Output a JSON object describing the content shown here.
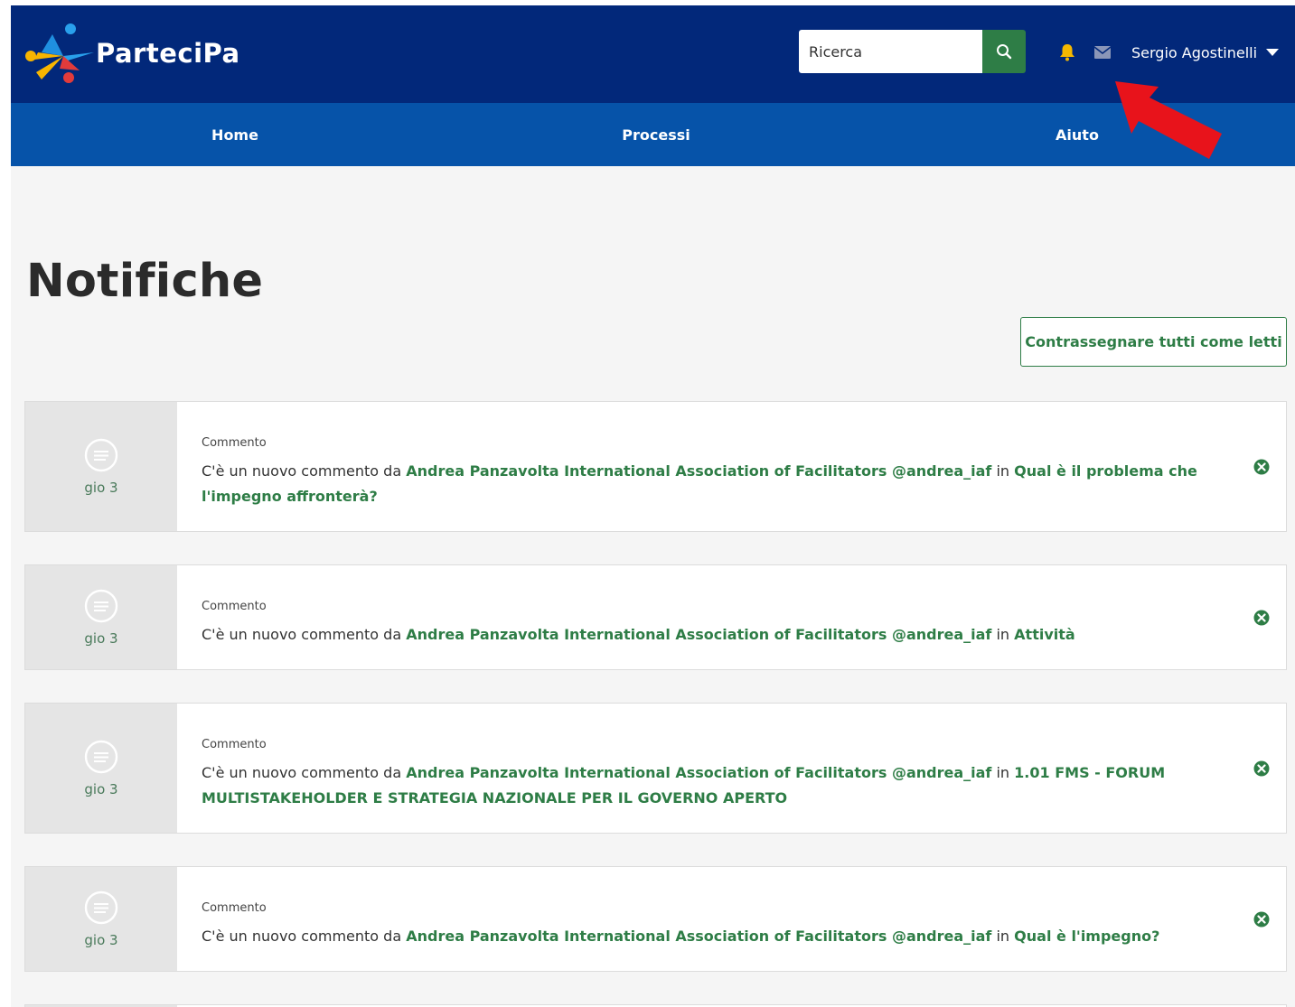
{
  "header": {
    "brand": "ParteciPa",
    "search_placeholder": "Ricerca",
    "user_name": "Sergio Agostinelli",
    "icons": {
      "search": "search-icon",
      "bell": "bell-icon",
      "mail": "envelope-icon",
      "caret": "caret-down-icon"
    }
  },
  "nav": {
    "items": [
      {
        "label": "Home"
      },
      {
        "label": "Processi"
      },
      {
        "label": "Aiuto"
      }
    ]
  },
  "page": {
    "title": "Notifiche",
    "mark_all_label": "Contrassegnare tutti come letti"
  },
  "notifications": [
    {
      "date": "gio 3",
      "type": "Commento",
      "prefix": "C'è un nuovo commento da",
      "author": "Andrea Panzavolta International Association of Facilitators @andrea_iaf",
      "connector": "in",
      "target": "Qual è il problema che l'impegno affronterà?"
    },
    {
      "date": "gio 3",
      "type": "Commento",
      "prefix": "C'è un nuovo commento da",
      "author": "Andrea Panzavolta International Association of Facilitators @andrea_iaf",
      "connector": "in",
      "target": "Attività"
    },
    {
      "date": "gio 3",
      "type": "Commento",
      "prefix": "C'è un nuovo commento da",
      "author": "Andrea Panzavolta International Association of Facilitators @andrea_iaf",
      "connector": "in",
      "target": "1.01 FMS - FORUM MULTISTAKEHOLDER E STRATEGIA NAZIONALE PER IL GOVERNO APERTO"
    },
    {
      "date": "gio 3",
      "type": "Commento",
      "prefix": "C'è un nuovo commento da",
      "author": "Andrea Panzavolta International Association of Facilitators @andrea_iaf",
      "connector": "in",
      "target": "Qual è l'impegno?"
    }
  ],
  "colors": {
    "header_dark": "#02287a",
    "nav_blue": "#0653a9",
    "accent_green": "#2e7d46",
    "bell_yellow": "#f5b800",
    "annotation_red": "#e8131b"
  }
}
